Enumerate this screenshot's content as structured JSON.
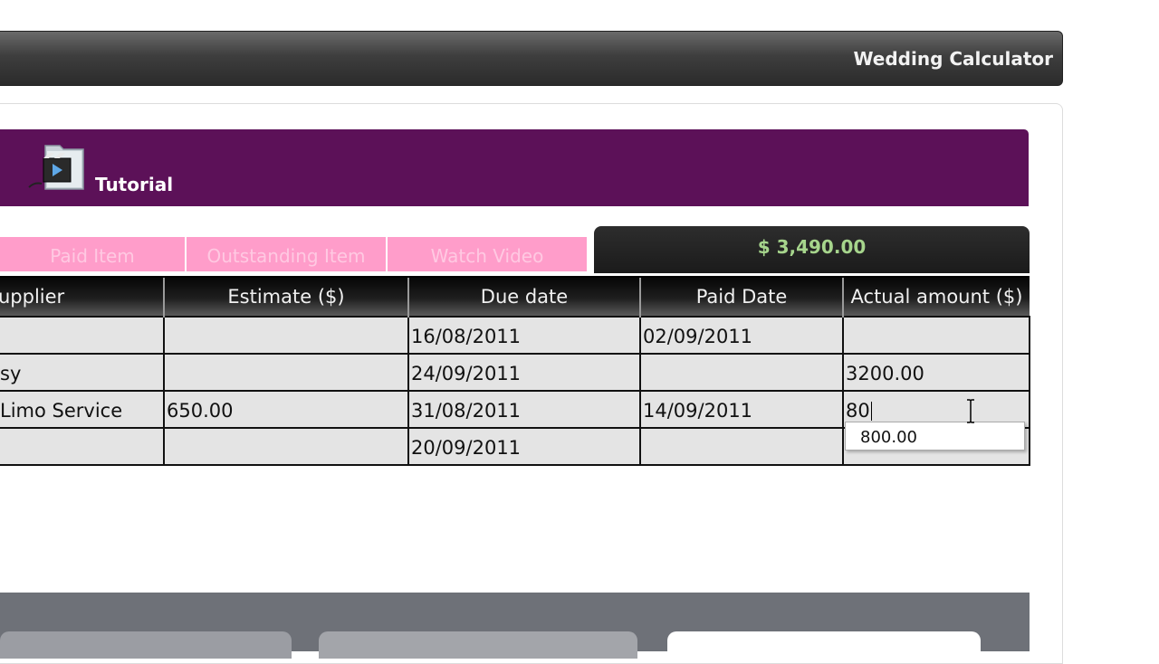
{
  "header": {
    "app_title": "Wedding Calculator"
  },
  "banner": {
    "tutorial_label": "Tutorial"
  },
  "tabs": [
    {
      "label": "Paid Item"
    },
    {
      "label": "Outstanding Item"
    },
    {
      "label": "Watch Video"
    }
  ],
  "total": {
    "amount": "$ 3,490.00"
  },
  "table": {
    "columns": [
      "upplier",
      "Estimate ($)",
      "Due date",
      "Paid Date",
      "Actual amount ($)"
    ],
    "rows": [
      [
        "",
        "",
        "16/08/2011",
        "02/09/2011",
        ""
      ],
      [
        "sy",
        "",
        "24/09/2011",
        "",
        "3200.00"
      ],
      [
        "Limo Service",
        "650.00",
        "31/08/2011",
        "14/09/2011",
        "80"
      ],
      [
        "",
        "",
        "20/09/2011",
        "",
        ""
      ]
    ]
  },
  "autocomplete": {
    "suggestion": "800.00"
  },
  "colors": {
    "banner": "#5c1158",
    "tab": "#ff9dca",
    "total_text": "#a6d58c"
  }
}
